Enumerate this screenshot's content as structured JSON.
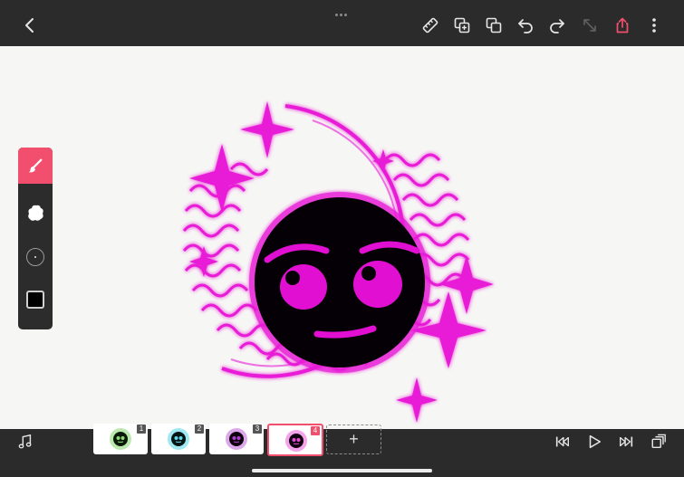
{
  "top_bar": {
    "icons": [
      "back-chevron-icon",
      "ruler-icon",
      "duplicate-frame-icon",
      "copy-icon",
      "undo-icon",
      "redo-icon",
      "resize-icon",
      "share-icon",
      "more-vertical-icon"
    ],
    "accent_color": "#f24e6e"
  },
  "tools": {
    "items": [
      "brush",
      "eraser",
      "brush-size",
      "color"
    ],
    "selected": "brush",
    "current_color": "#000000"
  },
  "artwork": {
    "palette": {
      "magenta": "#e81ad6",
      "face": "#050005",
      "features": "#e10fd1"
    }
  },
  "timeline": {
    "frames": [
      {
        "number": "1",
        "tint": "#8fd87a"
      },
      {
        "number": "2",
        "tint": "#5fd8e8"
      },
      {
        "number": "3",
        "tint": "#b040d0"
      },
      {
        "number": "4",
        "tint": "#e84ad6"
      }
    ],
    "selected_frame": "4",
    "add_label": "+"
  },
  "playback": {
    "icons": [
      "skip-to-start-icon",
      "play-icon",
      "skip-to-end-icon",
      "layers-icon"
    ]
  }
}
